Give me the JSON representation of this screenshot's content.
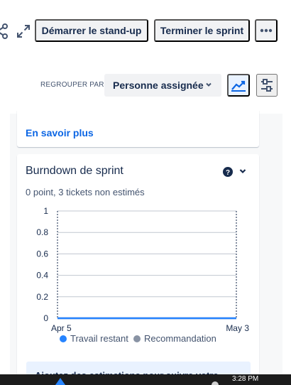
{
  "toolbar": {
    "start_label": "Démarrer le stand-up",
    "end_label": "Terminer le sprint",
    "share_icon": "share-icon",
    "expand_icon": "expand-icon",
    "more_icon": "more-icon"
  },
  "grouping": {
    "label": "REGROUPER PAR",
    "selected": "Personne assignée",
    "chart_icon": "chart-icon",
    "filter_icon": "filter-icon"
  },
  "top_card": {
    "link": "En savoir plus"
  },
  "burndown": {
    "title": "Burndown de sprint",
    "subtitle": "0 point, 3 tickets non estimés",
    "help_icon": "help-icon",
    "chevron_icon": "chevron-down-icon"
  },
  "chart_data": {
    "type": "line",
    "title": "Burndown de sprint",
    "x_labels": [
      "Apr 5",
      "May 3"
    ],
    "y_ticks": [
      "1",
      "0.8",
      "0.6",
      "0.4",
      "0.2",
      "0"
    ],
    "ylim": [
      0,
      1
    ],
    "series": [
      {
        "name": "Travail restant",
        "color": "#2684ff",
        "values": [
          0,
          0
        ]
      },
      {
        "name": "Recommandation",
        "color": "#8993a4",
        "values": [
          0,
          0
        ]
      }
    ],
    "grid": true,
    "legend": "bottom"
  },
  "info_card": {
    "text": "Ajoutez des estimations pour suivre votre"
  },
  "taskbar": {
    "time": "3:28 PM"
  },
  "colors": {
    "accent": "#0c66e4",
    "button_bg": "#f1f2f4",
    "text": "#172b4d"
  }
}
